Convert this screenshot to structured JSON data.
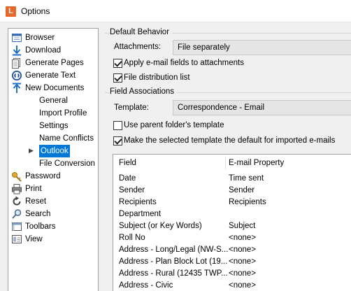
{
  "window": {
    "title": "Options",
    "icon_letter": "L"
  },
  "tree": {
    "items": [
      {
        "label": "Browser",
        "icon": "browser-icon"
      },
      {
        "label": "Download",
        "icon": "download-icon"
      },
      {
        "label": "Generate Pages",
        "icon": "generate-pages-icon"
      },
      {
        "label": "Generate Text",
        "icon": "generate-text-icon"
      },
      {
        "label": "New Documents",
        "icon": "new-documents-icon"
      },
      {
        "label": "General"
      },
      {
        "label": "Import Profile"
      },
      {
        "label": "Settings"
      },
      {
        "label": "Name Conflicts"
      },
      {
        "label": "Outlook",
        "selected": true
      },
      {
        "label": "File Conversion"
      },
      {
        "label": "Password",
        "icon": "key-icon"
      },
      {
        "label": "Print",
        "icon": "printer-icon"
      },
      {
        "label": "Reset",
        "icon": "reset-icon"
      },
      {
        "label": "Search",
        "icon": "search-icon"
      },
      {
        "label": "Toolbars",
        "icon": "toolbars-icon"
      },
      {
        "label": "View",
        "icon": "view-icon"
      }
    ]
  },
  "default_behavior": {
    "title": "Default Behavior",
    "attachments_label": "Attachments:",
    "attachments_value": "File separately",
    "apply_email_fields_label": "Apply e-mail fields to attachments",
    "apply_email_fields_checked": true,
    "file_distribution_label": "File distribution list",
    "file_distribution_checked": true
  },
  "field_associations": {
    "title": "Field Associations",
    "template_label": "Template:",
    "template_value": "Correspondence - Email",
    "use_parent_label": "Use parent folder's template",
    "use_parent_checked": false,
    "make_default_label": "Make the selected template the default for imported e-mails",
    "make_default_checked": true,
    "columns": [
      "Field",
      "E-mail Property"
    ],
    "rows": [
      [
        "Date",
        "Time sent"
      ],
      [
        "Sender",
        "Sender"
      ],
      [
        "Recipients",
        "Recipients"
      ],
      [
        "Department",
        ""
      ],
      [
        "Subject (or Key Words)",
        "Subject"
      ],
      [
        "Roll No",
        "<none>"
      ],
      [
        "Address - Long/Legal (NW-S...",
        "<none>"
      ],
      [
        "Address - Plan Block Lot (19...",
        "<none>"
      ],
      [
        "Address - Rural (12435 TWP...",
        "<none>"
      ],
      [
        "Address - Civic",
        "<none>"
      ]
    ]
  },
  "colors": {
    "selection": "#0078d7",
    "app_icon": "#e8672a"
  }
}
